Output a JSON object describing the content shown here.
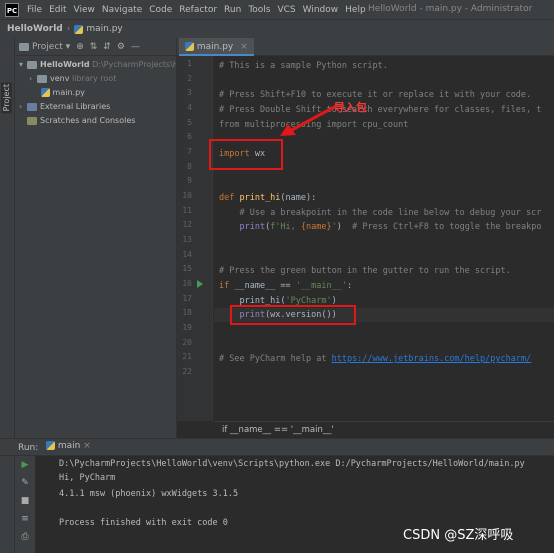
{
  "window": {
    "logo_text": "PC",
    "title": "HelloWorld - main.py - Administrator"
  },
  "menu": [
    "File",
    "Edit",
    "View",
    "Navigate",
    "Code",
    "Refactor",
    "Run",
    "Tools",
    "VCS",
    "Window",
    "Help"
  ],
  "breadcrumb": {
    "project": "HelloWorld",
    "file": "main.py"
  },
  "left_stripe_label": "Project",
  "project_panel": {
    "title": "Project",
    "tree": [
      {
        "label": "HelloWorld",
        "detail": "D:\\PycharmProjects\\HelloWorld"
      },
      {
        "label": "venv",
        "detail": "library root"
      },
      {
        "label": "main.py",
        "detail": ""
      },
      {
        "label": "External Libraries",
        "detail": ""
      },
      {
        "label": "Scratches and Consoles",
        "detail": ""
      }
    ]
  },
  "editor": {
    "tab": "main.py",
    "lines": [
      "1",
      "2",
      "3",
      "4",
      "5",
      "6",
      "7",
      "8",
      "9",
      "10",
      "11",
      "12",
      "13",
      "14",
      "15",
      "16",
      "17",
      "18",
      "19",
      "20",
      "21",
      "22"
    ],
    "code": {
      "l1": "# This is a sample Python script.",
      "l3": "# Press Shift+F10 to execute it or replace it with your code.",
      "l4": "# Press Double Shift to search everywhere for classes, files, t",
      "l5": "from multiprocessing import cpu_count",
      "l7_kw": "import",
      "l7_mod": " wx",
      "l10_kw": "def",
      "l10_fn": " print_hi",
      "l10_rest": "(name):",
      "l11": "    # Use a breakpoint in the code line below to debug your scr",
      "l12_fn": "    print",
      "l12_a": "(",
      "l12_str": "f'Hi, ",
      "l12_b": "{name}",
      "l12_str2": "'",
      "l12_c": ")  ",
      "l12_cm": "# Press Ctrl+F8 to toggle the breakpo",
      "l15": "# Press the green button in the gutter to run the script.",
      "l16_kw": "if",
      "l16_a": " __name__ == ",
      "l16_str": "'__main__'",
      "l16_b": ":",
      "l17_a": "    print_hi(",
      "l17_str": "'PyCharm'",
      "l17_b": ")",
      "l18_fn": "    print",
      "l18_a": "(wx.version())",
      "l21_cm": "# See PyCharm help at ",
      "l21_link": "https://www.jetbrains.com/help/pycharm/"
    },
    "annotation": "导入包",
    "footer_breadcrumb": "if __name__ == '__main__'"
  },
  "run_panel": {
    "label": "Run:",
    "tab": "main",
    "console": [
      "D:\\PycharmProjects\\HelloWorld\\venv\\Scripts\\python.exe D:/PycharmProjects/HelloWorld/main.py",
      "Hi, PyCharm",
      "4.1.1 msw (phoenix) wxWidgets 3.1.5",
      "",
      "Process finished with exit code 0"
    ]
  },
  "watermark": "CSDN @SZ深呼吸",
  "colors": {
    "background": "#2b2b2b",
    "panel": "#3c3f41",
    "annotation_red": "#e21818",
    "keyword": "#cc7832",
    "string": "#6a8759",
    "function": "#ffc66d",
    "comment": "#808080"
  }
}
